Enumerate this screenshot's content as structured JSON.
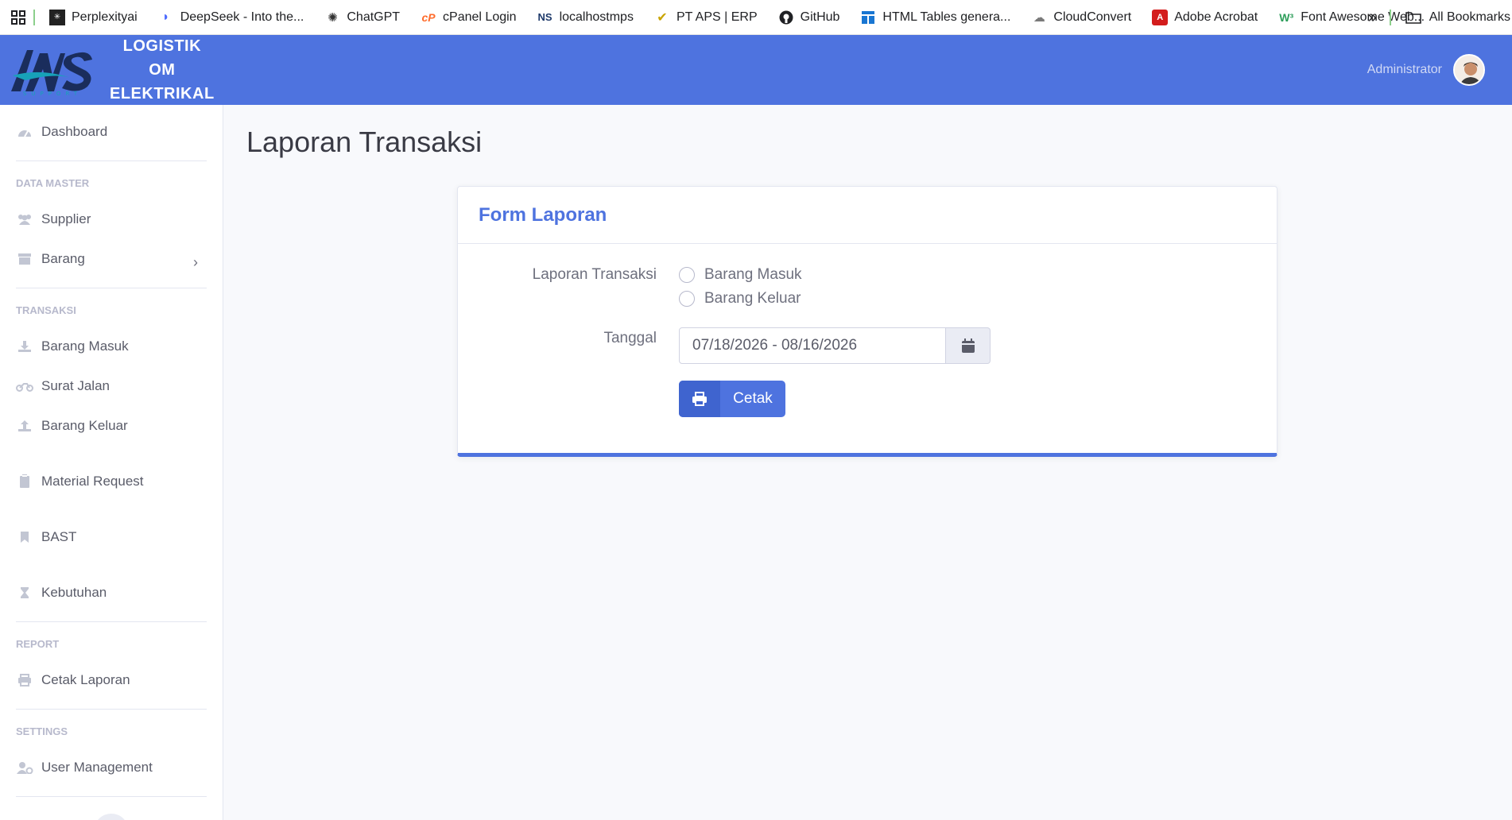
{
  "bookmarks": {
    "items": [
      {
        "label": "Perplexityai",
        "icon": "perplexity-icon"
      },
      {
        "label": "DeepSeek - Into the...",
        "icon": "deepseek-icon"
      },
      {
        "label": "ChatGPT",
        "icon": "chatgpt-icon"
      },
      {
        "label": "cPanel Login",
        "icon": "cpanel-icon"
      },
      {
        "label": "localhostmps",
        "icon": "localhost-icon"
      },
      {
        "label": "PT APS | ERP",
        "icon": "erp-icon"
      },
      {
        "label": "GitHub",
        "icon": "github-icon"
      },
      {
        "label": "HTML Tables genera...",
        "icon": "tables-icon"
      },
      {
        "label": "CloudConvert",
        "icon": "cloudconvert-icon"
      },
      {
        "label": "Adobe Acrobat",
        "icon": "acrobat-icon"
      },
      {
        "label": "Font Awesome Web...",
        "icon": "fontawesome-icon"
      }
    ],
    "more": "»",
    "all_bookmarks": "All Bookmarks"
  },
  "topbar": {
    "brand_lines": [
      "LOGISTIK",
      "OM",
      "ELEKTRIKAL"
    ],
    "user_name": "Administrator",
    "accent": "#4e73df"
  },
  "sidebar": {
    "dashboard": "Dashboard",
    "sections": {
      "data_master": "DATA MASTER",
      "transaksi": "TRANSAKSI",
      "report": "REPORT",
      "settings": "SETTINGS"
    },
    "items": {
      "supplier": "Supplier",
      "barang": "Barang",
      "barang_masuk": "Barang Masuk",
      "surat_jalan": "Surat Jalan",
      "barang_keluar": "Barang Keluar",
      "material_request": "Material Request",
      "bast": "BAST",
      "kebutuhan": "Kebutuhan",
      "cetak_laporan": "Cetak Laporan",
      "user_management": "User Management"
    }
  },
  "main": {
    "page_title": "Laporan Transaksi",
    "card_title": "Form Laporan",
    "form": {
      "laporan_label": "Laporan Transaksi",
      "radio_options": [
        "Barang Masuk",
        "Barang Keluar"
      ],
      "tanggal_label": "Tanggal",
      "date_range": "07/18/2026 - 08/16/2026",
      "print_label": "Cetak"
    }
  }
}
